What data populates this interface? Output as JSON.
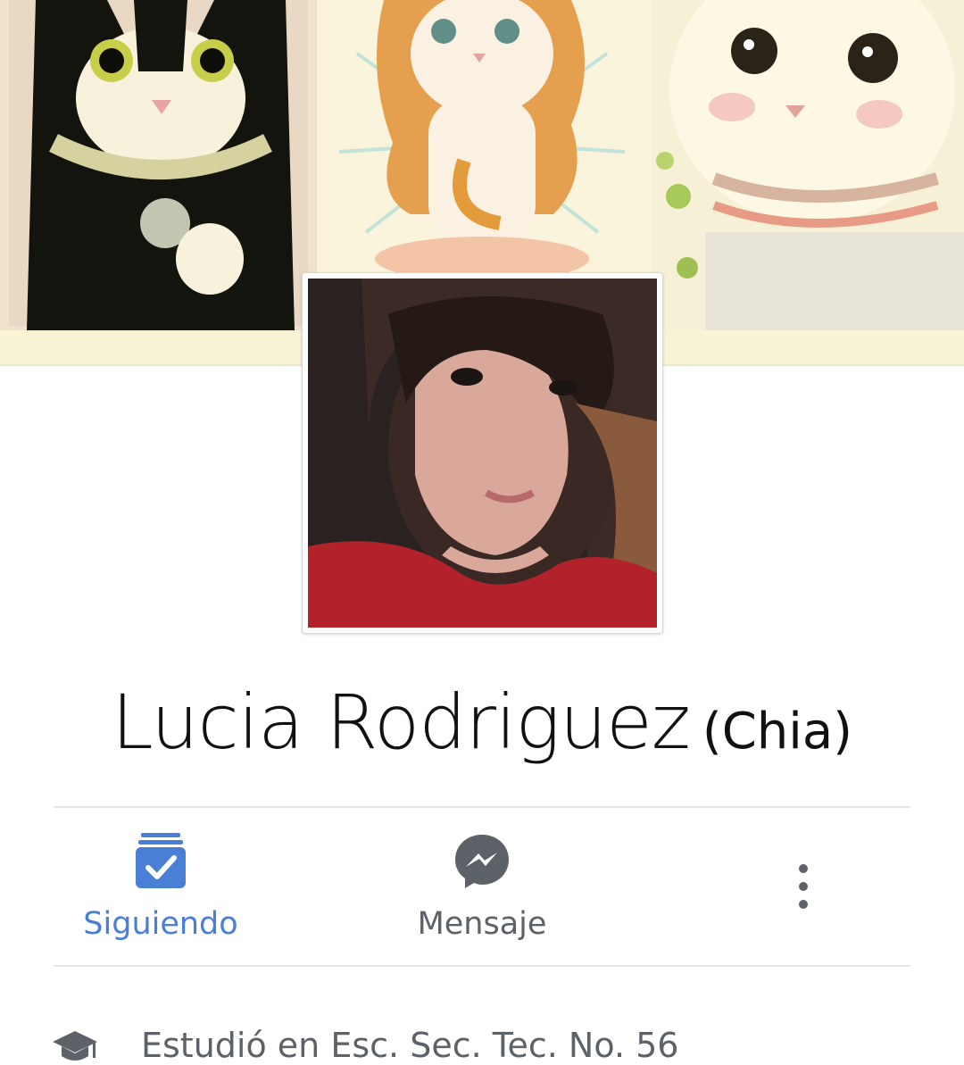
{
  "profile": {
    "name": "Lucia Rodriguez",
    "alternate_name": "(Chia)"
  },
  "actions": {
    "follow_label": "Siguiendo",
    "message_label": "Mensaje"
  },
  "icons": {
    "follow": "following-check-icon",
    "message": "messenger-icon",
    "more": "more-vertical-icon",
    "education": "graduation-cap-icon"
  },
  "info": {
    "education_text": "Estudió en Esc. Sec. Tec. No. 56"
  },
  "colors": {
    "accent_blue": "#4a7fd6",
    "icon_gray": "#5d6168",
    "text_dark": "#111111"
  }
}
